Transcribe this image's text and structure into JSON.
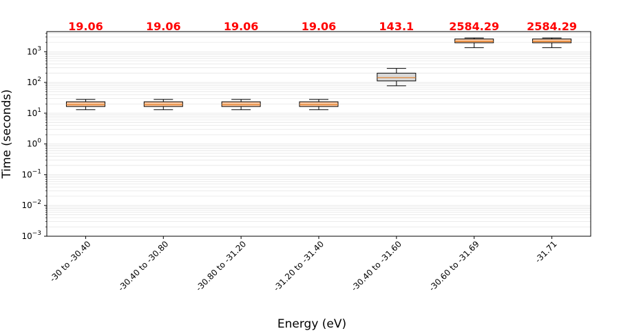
{
  "chart_data": {
    "type": "box",
    "title": "",
    "xlabel": "Energy (eV)",
    "ylabel": "Time (seconds)",
    "yscale": "log",
    "ylim": [
      0.001,
      4500
    ],
    "yticks": [
      {
        "value": 0.001,
        "base": "10",
        "exp": "−3"
      },
      {
        "value": 0.01,
        "base": "10",
        "exp": "−2"
      },
      {
        "value": 0.1,
        "base": "10",
        "exp": "−1"
      },
      {
        "value": 1,
        "base": "10",
        "exp": "0"
      },
      {
        "value": 10,
        "base": "10",
        "exp": "1"
      },
      {
        "value": 100,
        "base": "10",
        "exp": "2"
      },
      {
        "value": 1000,
        "base": "10",
        "exp": "3"
      }
    ],
    "grid": "horizontal minor",
    "label_color": "#ff0000",
    "categories": [
      "-30 to -30.40",
      "-30.40 to -30.80",
      "-30.80 to -31.20",
      "-31.20 to -31.40",
      "-30.40 to -31.60",
      "-30.60 to -31.69",
      "-31.71"
    ],
    "data_labels": [
      "19.06",
      "19.06",
      "19.06",
      "19.06",
      "143.1",
      "2584.29",
      "2584.29"
    ],
    "boxes": [
      {
        "whisker_low": 13,
        "q1": 16.5,
        "median": 19.06,
        "q3": 23.5,
        "whisker_high": 28,
        "fill": "#ffc8a0"
      },
      {
        "whisker_low": 13,
        "q1": 16.5,
        "median": 19.06,
        "q3": 23.5,
        "whisker_high": 28,
        "fill": "#ffc8a0"
      },
      {
        "whisker_low": 13,
        "q1": 16.5,
        "median": 19.06,
        "q3": 23.5,
        "whisker_high": 28,
        "fill": "#ffc8a0"
      },
      {
        "whisker_low": 13,
        "q1": 16.5,
        "median": 19.06,
        "q3": 23.5,
        "whisker_high": 28,
        "fill": "#ffc8a0"
      },
      {
        "whisker_low": 78,
        "q1": 112,
        "median": 143.1,
        "q3": 200,
        "whisker_high": 285,
        "fill": "#d9d9d9"
      },
      {
        "whisker_low": 1350,
        "q1": 1950,
        "median": 2150,
        "q3": 2584.29,
        "whisker_high": 2800,
        "fill": "#ffc8a0"
      },
      {
        "whisker_low": 1350,
        "q1": 1950,
        "median": 2150,
        "q3": 2584.29,
        "whisker_high": 2800,
        "fill": "#ffc8a0"
      }
    ]
  }
}
